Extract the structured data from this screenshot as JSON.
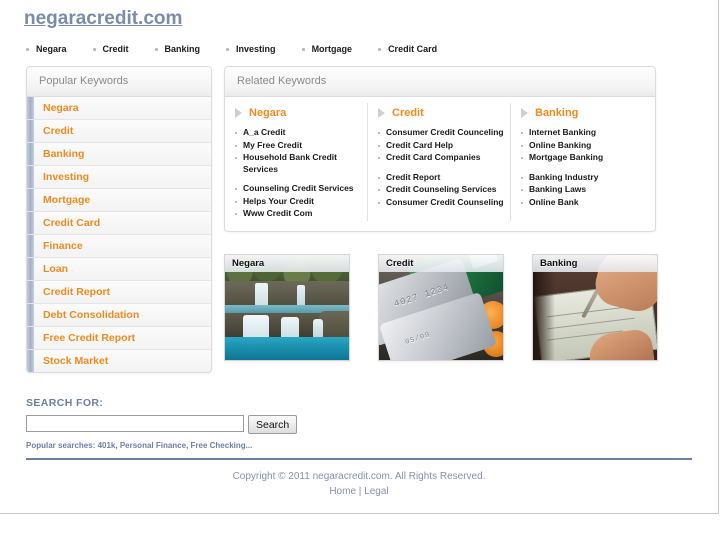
{
  "site": {
    "title": "negaracredit.com"
  },
  "topnav": {
    "items": [
      {
        "label": "Negara"
      },
      {
        "label": "Credit"
      },
      {
        "label": "Banking"
      },
      {
        "label": "Investing"
      },
      {
        "label": "Mortgage"
      },
      {
        "label": "Credit Card"
      }
    ]
  },
  "sidebar": {
    "heading": "Popular Keywords",
    "items": [
      {
        "label": "Negara"
      },
      {
        "label": "Credit"
      },
      {
        "label": "Banking"
      },
      {
        "label": "Investing"
      },
      {
        "label": "Mortgage"
      },
      {
        "label": "Credit Card"
      },
      {
        "label": "Finance"
      },
      {
        "label": "Loan"
      },
      {
        "label": "Credit Report"
      },
      {
        "label": "Debt Consolidation"
      },
      {
        "label": "Free Credit Report"
      },
      {
        "label": "Stock Market"
      }
    ]
  },
  "related": {
    "heading": "Related Keywords",
    "columns": [
      {
        "title": "Negara",
        "group1": [
          "A_a Credit",
          "My Free Credit",
          "Household Bank Credit Services"
        ],
        "group2": [
          "Counseling Credit Services",
          "Helps Your Credit",
          "Www Credit Com"
        ]
      },
      {
        "title": "Credit",
        "group1": [
          "Consumer Credit Counceling",
          "Credit Card Help",
          "Credit Card Companies"
        ],
        "group2": [
          "Credit Report",
          "Credit Counseling Services",
          "Consumer Credit Counseling"
        ]
      },
      {
        "title": "Banking",
        "group1": [
          "Internet Banking",
          "Online Banking",
          "Mortgage Banking"
        ],
        "group2": [
          "Banking Industry",
          "Banking Laws",
          "Online Bank"
        ]
      }
    ]
  },
  "cards": [
    {
      "title": "Negara",
      "image": "waterfall-photo"
    },
    {
      "title": "Credit",
      "image": "credit-cards-photo"
    },
    {
      "title": "Banking",
      "image": "writing-check-photo"
    }
  ],
  "search": {
    "label": "SEARCH FOR:",
    "value": "",
    "placeholder": "",
    "button_label": "Search",
    "popular_text": "Popular searches: 401k, Personal Finance, Free Checking..."
  },
  "footer": {
    "copyright": "Copyright © 2011 negaracredit.com. All Rights Reserved.",
    "home_label": "Home",
    "separator": "|",
    "legal_label": "Legal"
  },
  "colors": {
    "accent_orange": "#f08a1e",
    "brand_blue": "#6d7fa3",
    "title_blue": "#7b8bab",
    "panel_border": "#dcdcdc"
  }
}
